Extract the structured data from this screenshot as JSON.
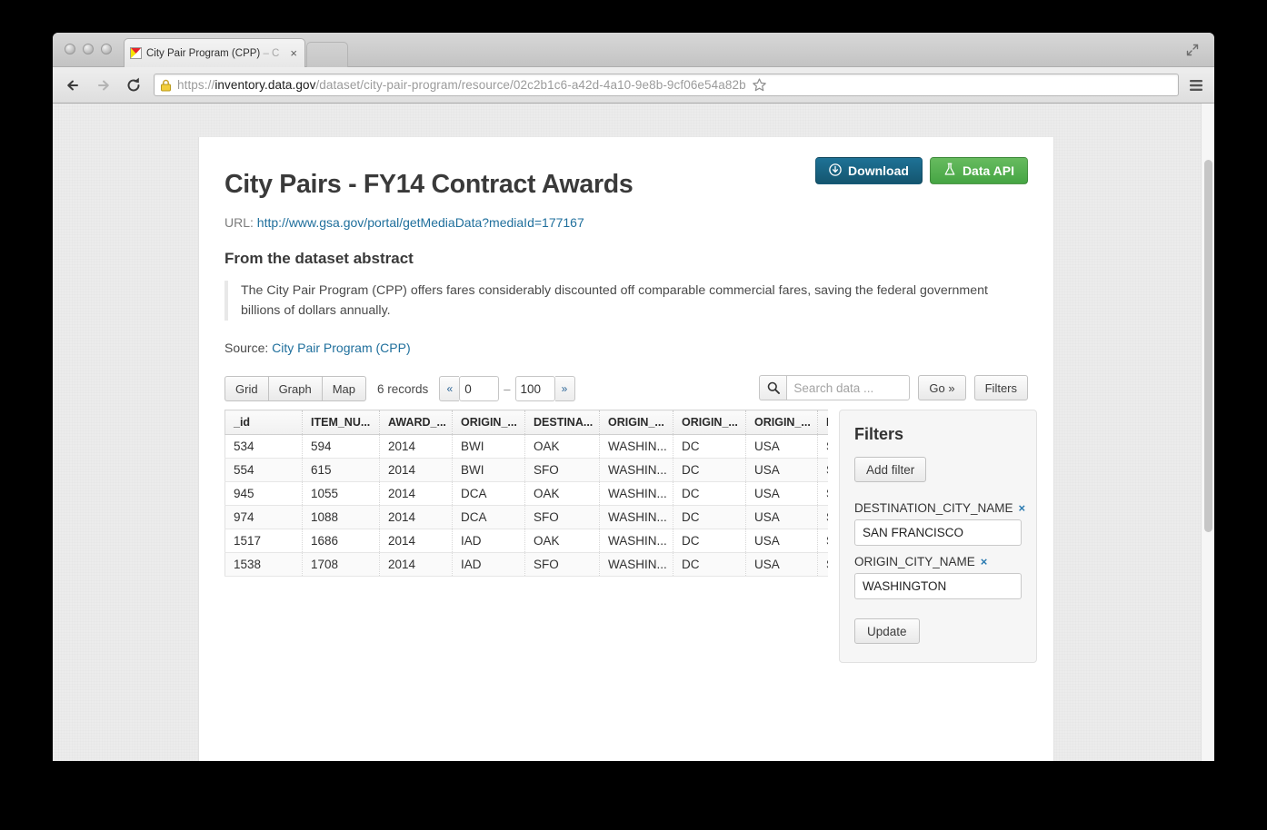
{
  "browser": {
    "tab_title": "City Pair Program (CPP)",
    "tab_title_dim": " – C",
    "close_glyph": "×",
    "url_scheme": "https://",
    "url_host": "inventory.data.gov",
    "url_path": "/dataset/city-pair-program/resource/02c2b1c6-a42d-4a10-9e8b-9cf06e54a82b",
    "back_icon": "back-arrow-icon",
    "forward_icon": "forward-arrow-icon",
    "reload_icon": "reload-icon",
    "lock_icon": "lock-icon",
    "star_icon": "bookmark-star-icon",
    "menu_icon": "hamburger-menu-icon",
    "fullscreen_icon": "fullscreen-icon",
    "favicon": "datagov-triangle-favicon"
  },
  "page": {
    "title": "City Pairs - FY14 Contract Awards",
    "url_label": "URL:",
    "url_link": "http://www.gsa.gov/portal/getMediaData?mediaId=177167",
    "abstract_heading": "From the dataset abstract",
    "abstract_text": "The City Pair Program (CPP) offers fares considerably discounted off comparable commercial fares, saving the federal government billions of dollars annually.",
    "source_label": "Source:",
    "source_link": "City Pair Program (CPP)",
    "buttons": {
      "download": "Download",
      "data_api": "Data API",
      "download_color": "#14566f",
      "data_api_color": "#46a544"
    }
  },
  "data_toolbar": {
    "views": [
      "Grid",
      "Graph",
      "Map"
    ],
    "active_view": "Grid",
    "records_count": "6 records",
    "pager_prev": "«",
    "pager_next": "»",
    "offset_value": "0",
    "limit_value": "100",
    "pager_separator": "–",
    "search_placeholder": "Search data ...",
    "search_value": "",
    "go_label": "Go »",
    "filters_label": "Filters",
    "search_icon": "search-icon"
  },
  "table": {
    "columns": [
      "_id",
      "ITEM_NU...",
      "AWARD_...",
      "ORIGIN_...",
      "DESTINA...",
      "ORIGIN_...",
      "ORIGIN_...",
      "ORIGIN_...",
      "DE..."
    ],
    "rows": [
      [
        "534",
        "594",
        "2014",
        "BWI",
        "OAK",
        "WASHIN...",
        "DC",
        "USA",
        "SA..."
      ],
      [
        "554",
        "615",
        "2014",
        "BWI",
        "SFO",
        "WASHIN...",
        "DC",
        "USA",
        "SA..."
      ],
      [
        "945",
        "1055",
        "2014",
        "DCA",
        "OAK",
        "WASHIN...",
        "DC",
        "USA",
        "SA..."
      ],
      [
        "974",
        "1088",
        "2014",
        "DCA",
        "SFO",
        "WASHIN...",
        "DC",
        "USA",
        "SA..."
      ],
      [
        "1517",
        "1686",
        "2014",
        "IAD",
        "OAK",
        "WASHIN...",
        "DC",
        "USA",
        "SA..."
      ],
      [
        "1538",
        "1708",
        "2014",
        "IAD",
        "SFO",
        "WASHIN...",
        "DC",
        "USA",
        "SA..."
      ]
    ]
  },
  "filters": {
    "title": "Filters",
    "add_filter": "Add filter",
    "remove_glyph": "×",
    "entries": [
      {
        "field": "DESTINATION_CITY_NAME",
        "value": "SAN FRANCISCO"
      },
      {
        "field": "ORIGIN_CITY_NAME",
        "value": "WASHINGTON"
      }
    ],
    "update": "Update"
  }
}
